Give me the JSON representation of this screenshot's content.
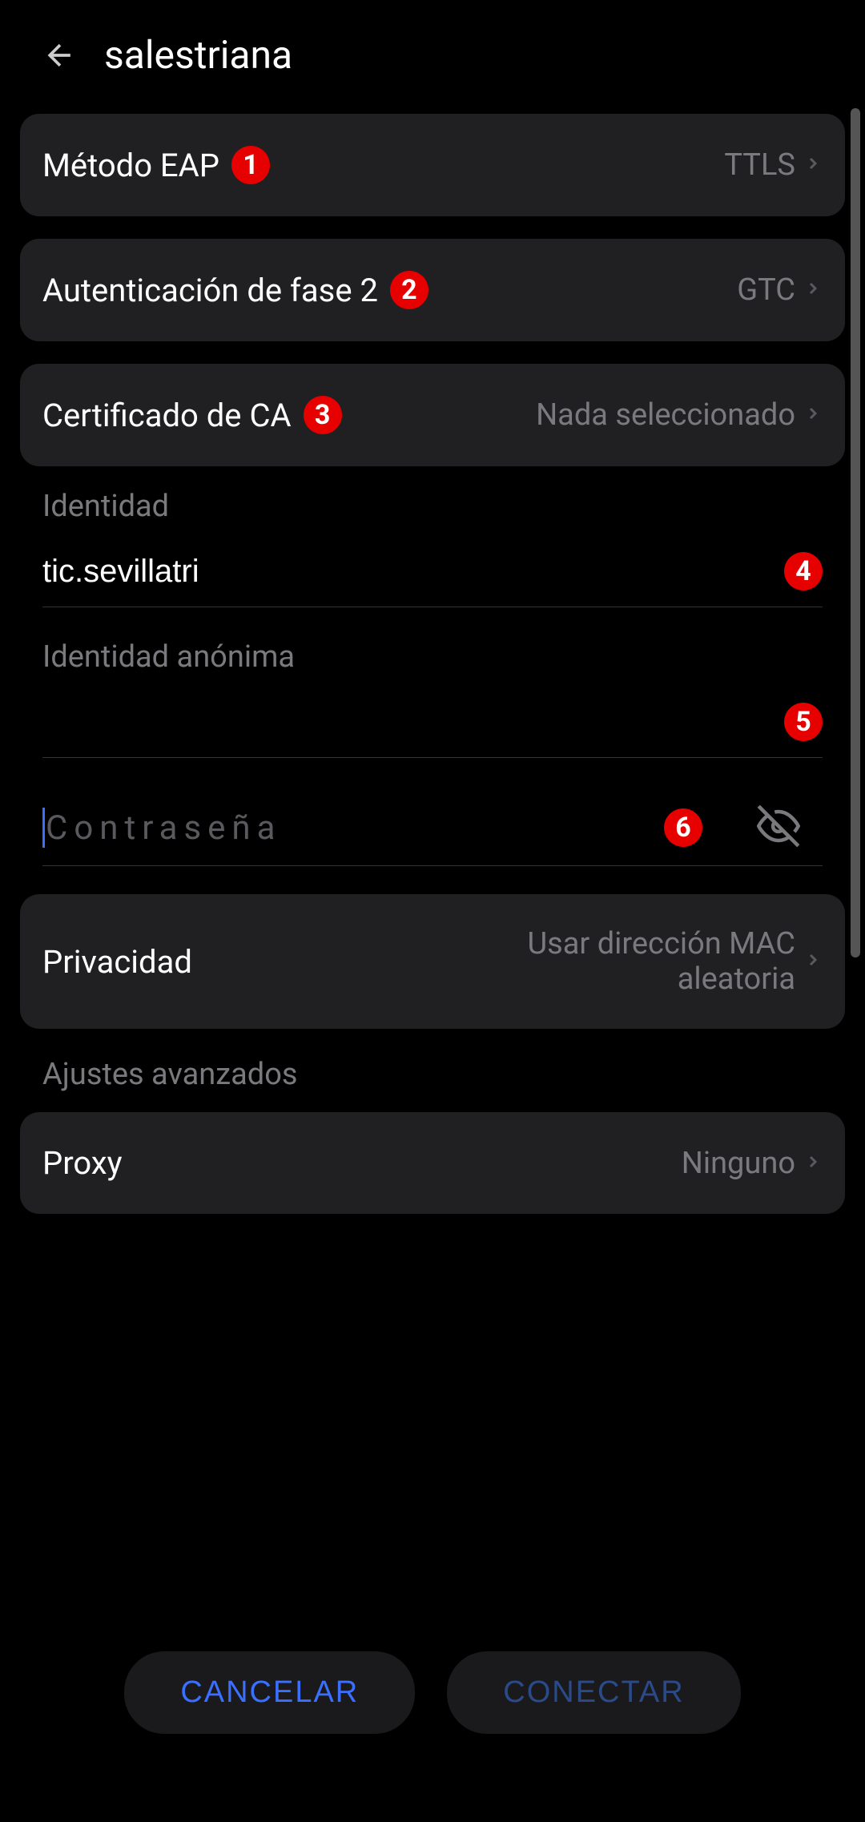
{
  "header": {
    "title": "salestriana"
  },
  "rows": {
    "eap": {
      "label": "Método EAP",
      "value": "TTLS",
      "badge": "1"
    },
    "phase2": {
      "label": "Autenticación de fase 2",
      "value": "GTC",
      "badge": "2"
    },
    "ca": {
      "label": "Certificado de CA",
      "value": "Nada seleccionado",
      "badge": "3"
    },
    "privacy": {
      "label": "Privacidad",
      "value": "Usar dirección MAC aleatoria"
    },
    "proxy": {
      "label": "Proxy",
      "value": "Ninguno"
    }
  },
  "fields": {
    "identity": {
      "label": "Identidad",
      "value": "tic.sevillatri",
      "badge": "4"
    },
    "anonymous": {
      "label": "Identidad anónima",
      "value": "",
      "badge": "5"
    },
    "password": {
      "placeholder": "Contraseña",
      "badge": "6"
    }
  },
  "sections": {
    "advanced": "Ajustes avanzados"
  },
  "buttons": {
    "cancel": "CANCELAR",
    "connect": "CONECTAR"
  }
}
